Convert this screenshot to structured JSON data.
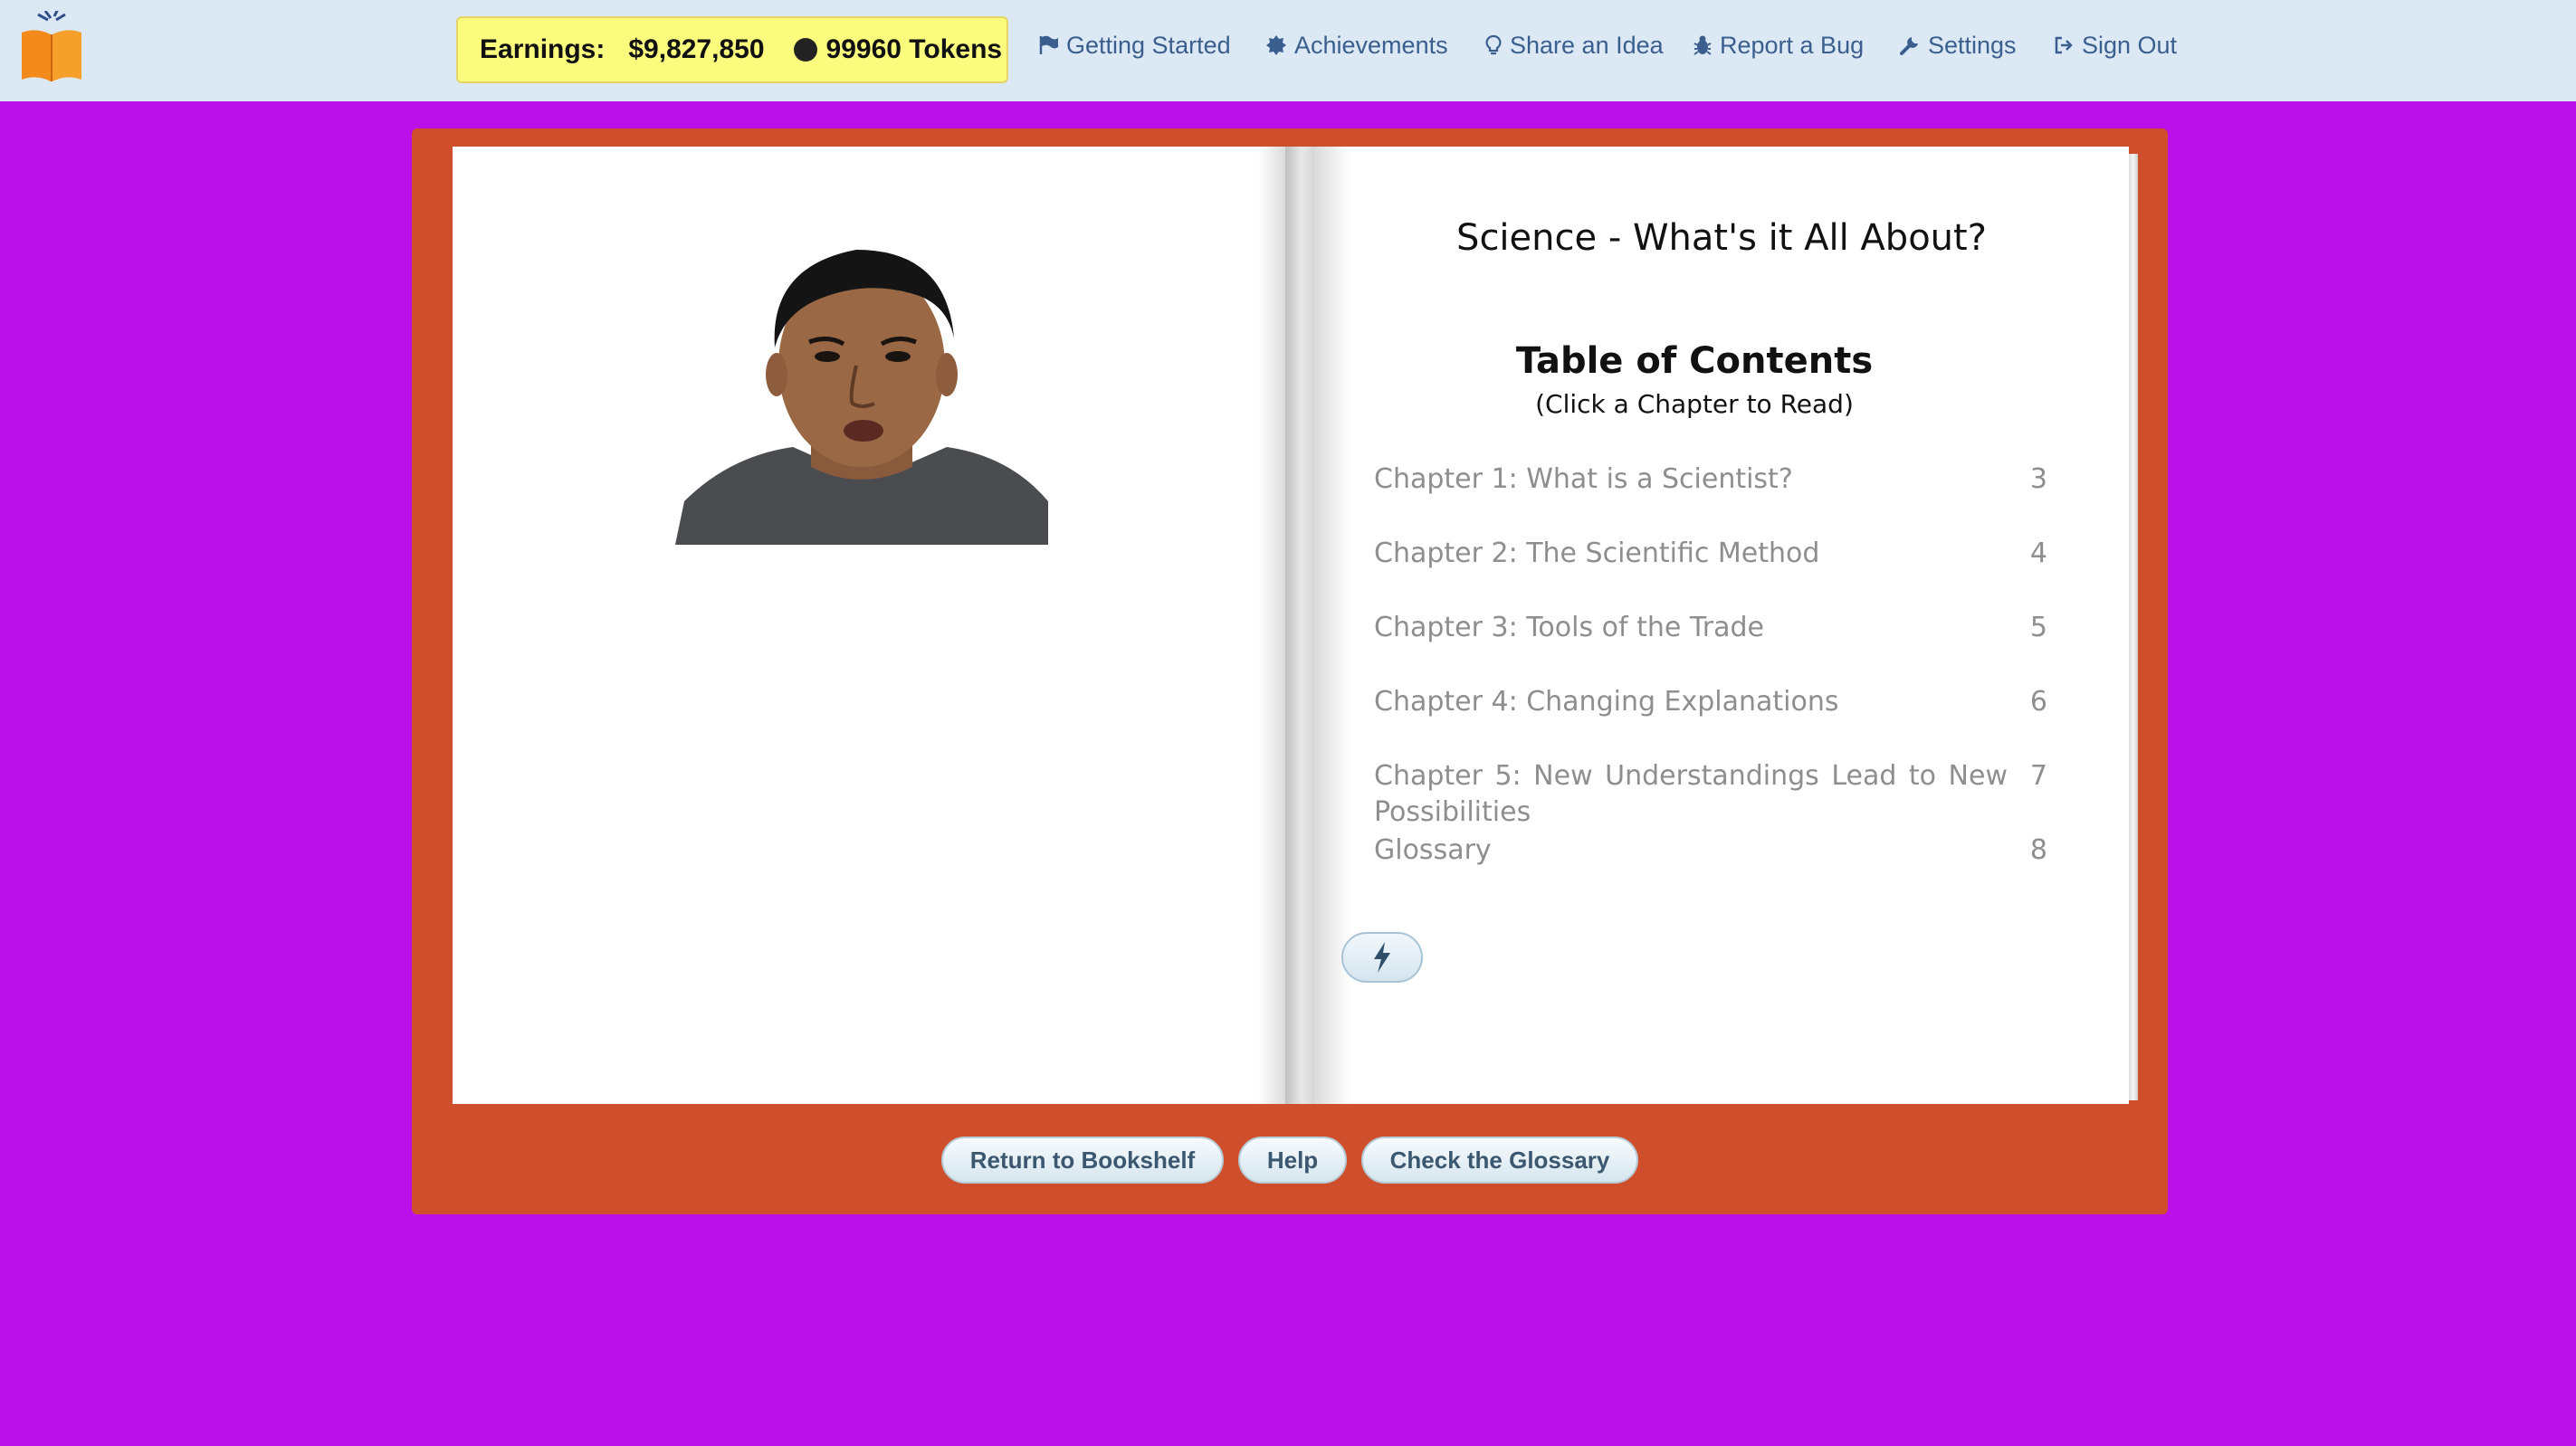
{
  "header": {
    "logo_icon": "open-book-icon",
    "earnings_label": "Earnings:",
    "earnings_amount": "$9,827,850",
    "tokens": "99960 Tokens",
    "nav": [
      {
        "label": "Getting Started",
        "icon": "flag-icon"
      },
      {
        "label": "Achievements",
        "icon": "badge-icon"
      },
      {
        "label": "Share an Idea",
        "icon": "lightbulb-icon"
      },
      {
        "label": "Report a Bug",
        "icon": "bug-icon"
      },
      {
        "label": "Settings",
        "icon": "wrench-icon"
      },
      {
        "label": "Sign Out",
        "icon": "sign-out-icon"
      }
    ]
  },
  "book": {
    "title": "Science - What's it All About?",
    "toc_heading": "Table of Contents",
    "toc_subheading": "(Click a Chapter to Read)",
    "chapters": [
      {
        "title": "Chapter 1:  What is a Scientist?",
        "page": "3"
      },
      {
        "title": "Chapter 2:  The Scientific Method",
        "page": "4"
      },
      {
        "title": "Chapter 3:  Tools of the Trade",
        "page": "5"
      },
      {
        "title": "Chapter 4:  Changing Explanations",
        "page": "6"
      },
      {
        "title": "Chapter 5:  New Understandings Lead to New Possibilities",
        "page": "7"
      },
      {
        "title": "Glossary",
        "page": "8"
      }
    ],
    "quick_button_icon": "lightning-bolt-icon"
  },
  "footer_buttons": {
    "return": "Return to Bookshelf",
    "help": "Help",
    "glossary": "Check the Glossary"
  },
  "colors": {
    "background": "#bb10e8",
    "frame": "#cf4f2c",
    "topbar": "#dce9f5",
    "earnings_bg": "#fbfc7e",
    "nav_text": "#3a5f8e"
  }
}
